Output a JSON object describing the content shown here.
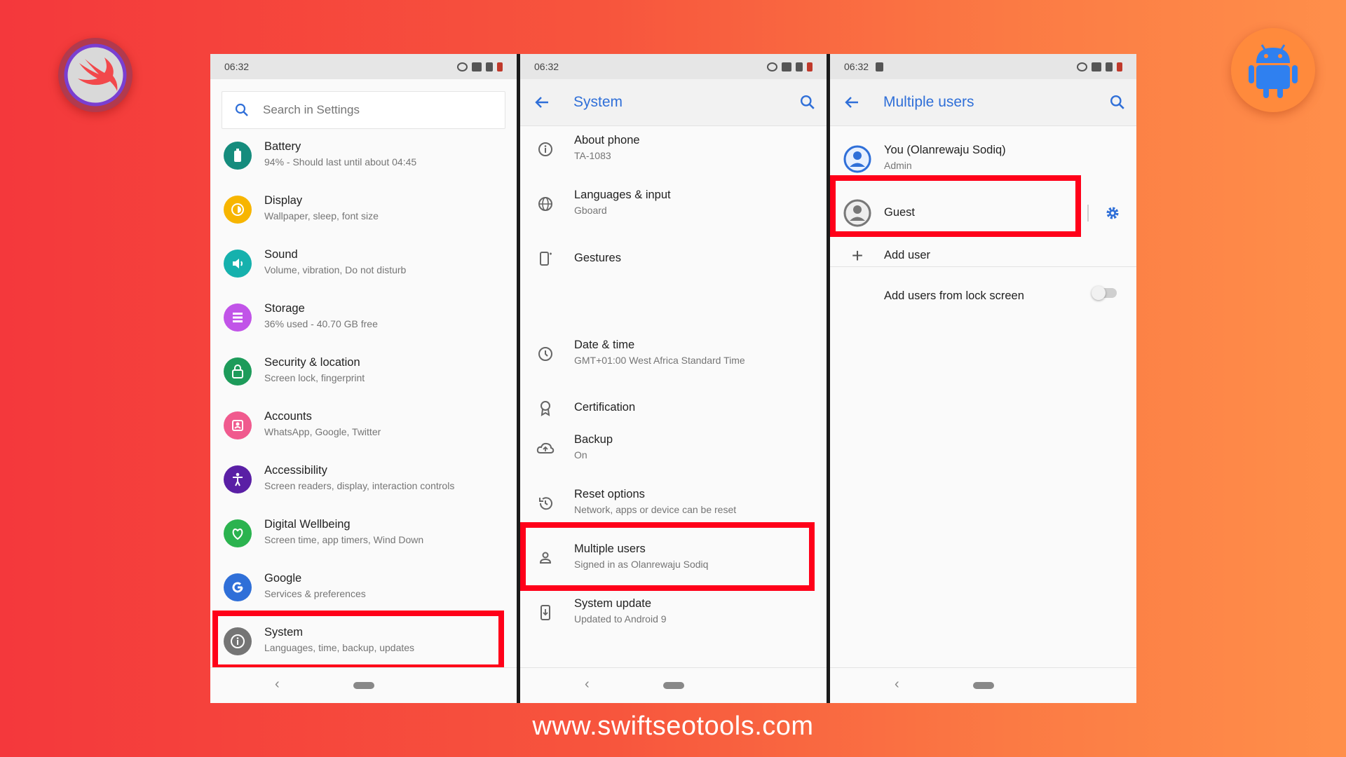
{
  "colors": {
    "accent": "#2f6fd8",
    "highlight": "#ff0019"
  },
  "footer_url": "www.swiftseotools.com",
  "logos": [
    "swift-logo",
    "android-logo"
  ],
  "screen1": {
    "status_time": "06:32",
    "search_placeholder": "Search in Settings",
    "items": [
      {
        "title": "Battery",
        "subtitle": "94% - Should last until about 04:45",
        "icon": "battery-icon",
        "color": "#158c7d"
      },
      {
        "title": "Display",
        "subtitle": "Wallpaper, sleep, font size",
        "icon": "brightness-icon",
        "color": "#f7b500"
      },
      {
        "title": "Sound",
        "subtitle": "Volume, vibration, Do not disturb",
        "icon": "volume-icon",
        "color": "#16b1ad"
      },
      {
        "title": "Storage",
        "subtitle": "36% used - 40.70 GB free",
        "icon": "storage-icon",
        "color": "#c154e8"
      },
      {
        "title": "Security & location",
        "subtitle": "Screen lock, fingerprint",
        "icon": "lock-icon",
        "color": "#1d9b5a"
      },
      {
        "title": "Accounts",
        "subtitle": "WhatsApp, Google, Twitter",
        "icon": "account-icon",
        "color": "#f05a8e"
      },
      {
        "title": "Accessibility",
        "subtitle": "Screen readers, display, interaction controls",
        "icon": "accessibility-icon",
        "color": "#5a1fa5"
      },
      {
        "title": "Digital Wellbeing",
        "subtitle": "Screen time, app timers, Wind Down",
        "icon": "wellbeing-icon",
        "color": "#2bb34f"
      },
      {
        "title": "Google",
        "subtitle": "Services & preferences",
        "icon": "google-icon",
        "color": "#2f6fd8"
      },
      {
        "title": "System",
        "subtitle": "Languages, time, backup, updates",
        "icon": "info-icon",
        "color": "#757575"
      }
    ]
  },
  "screen2": {
    "status_time": "06:32",
    "title": "System",
    "items": [
      {
        "title": "About phone",
        "subtitle": "TA-1083",
        "icon": "info-icon"
      },
      {
        "title": "Languages & input",
        "subtitle": "Gboard",
        "icon": "globe-icon"
      },
      {
        "title": "Gestures",
        "subtitle": "",
        "icon": "gestures-icon"
      },
      {
        "title": "Date & time",
        "subtitle": "GMT+01:00 West Africa Standard Time",
        "icon": "clock-icon"
      },
      {
        "title": "Certification",
        "subtitle": "",
        "icon": "certification-icon"
      },
      {
        "title": "Backup",
        "subtitle": "On",
        "icon": "backup-icon"
      },
      {
        "title": "Reset options",
        "subtitle": "Network, apps or device can be reset",
        "icon": "reset-icon"
      },
      {
        "title": "Multiple users",
        "subtitle": "Signed in as Olanrewaju Sodiq",
        "icon": "person-icon"
      },
      {
        "title": "System update",
        "subtitle": "Updated to Android 9",
        "icon": "system-update-icon"
      }
    ]
  },
  "screen3": {
    "status_time": "06:32",
    "title": "Multiple users",
    "users": [
      {
        "name": "You (Olanrewaju Sodiq)",
        "role": "Admin"
      },
      {
        "name": "Guest",
        "role": ""
      }
    ],
    "add_user": "Add user",
    "lock_screen_label": "Add users from lock screen",
    "lock_screen_enabled": false
  }
}
